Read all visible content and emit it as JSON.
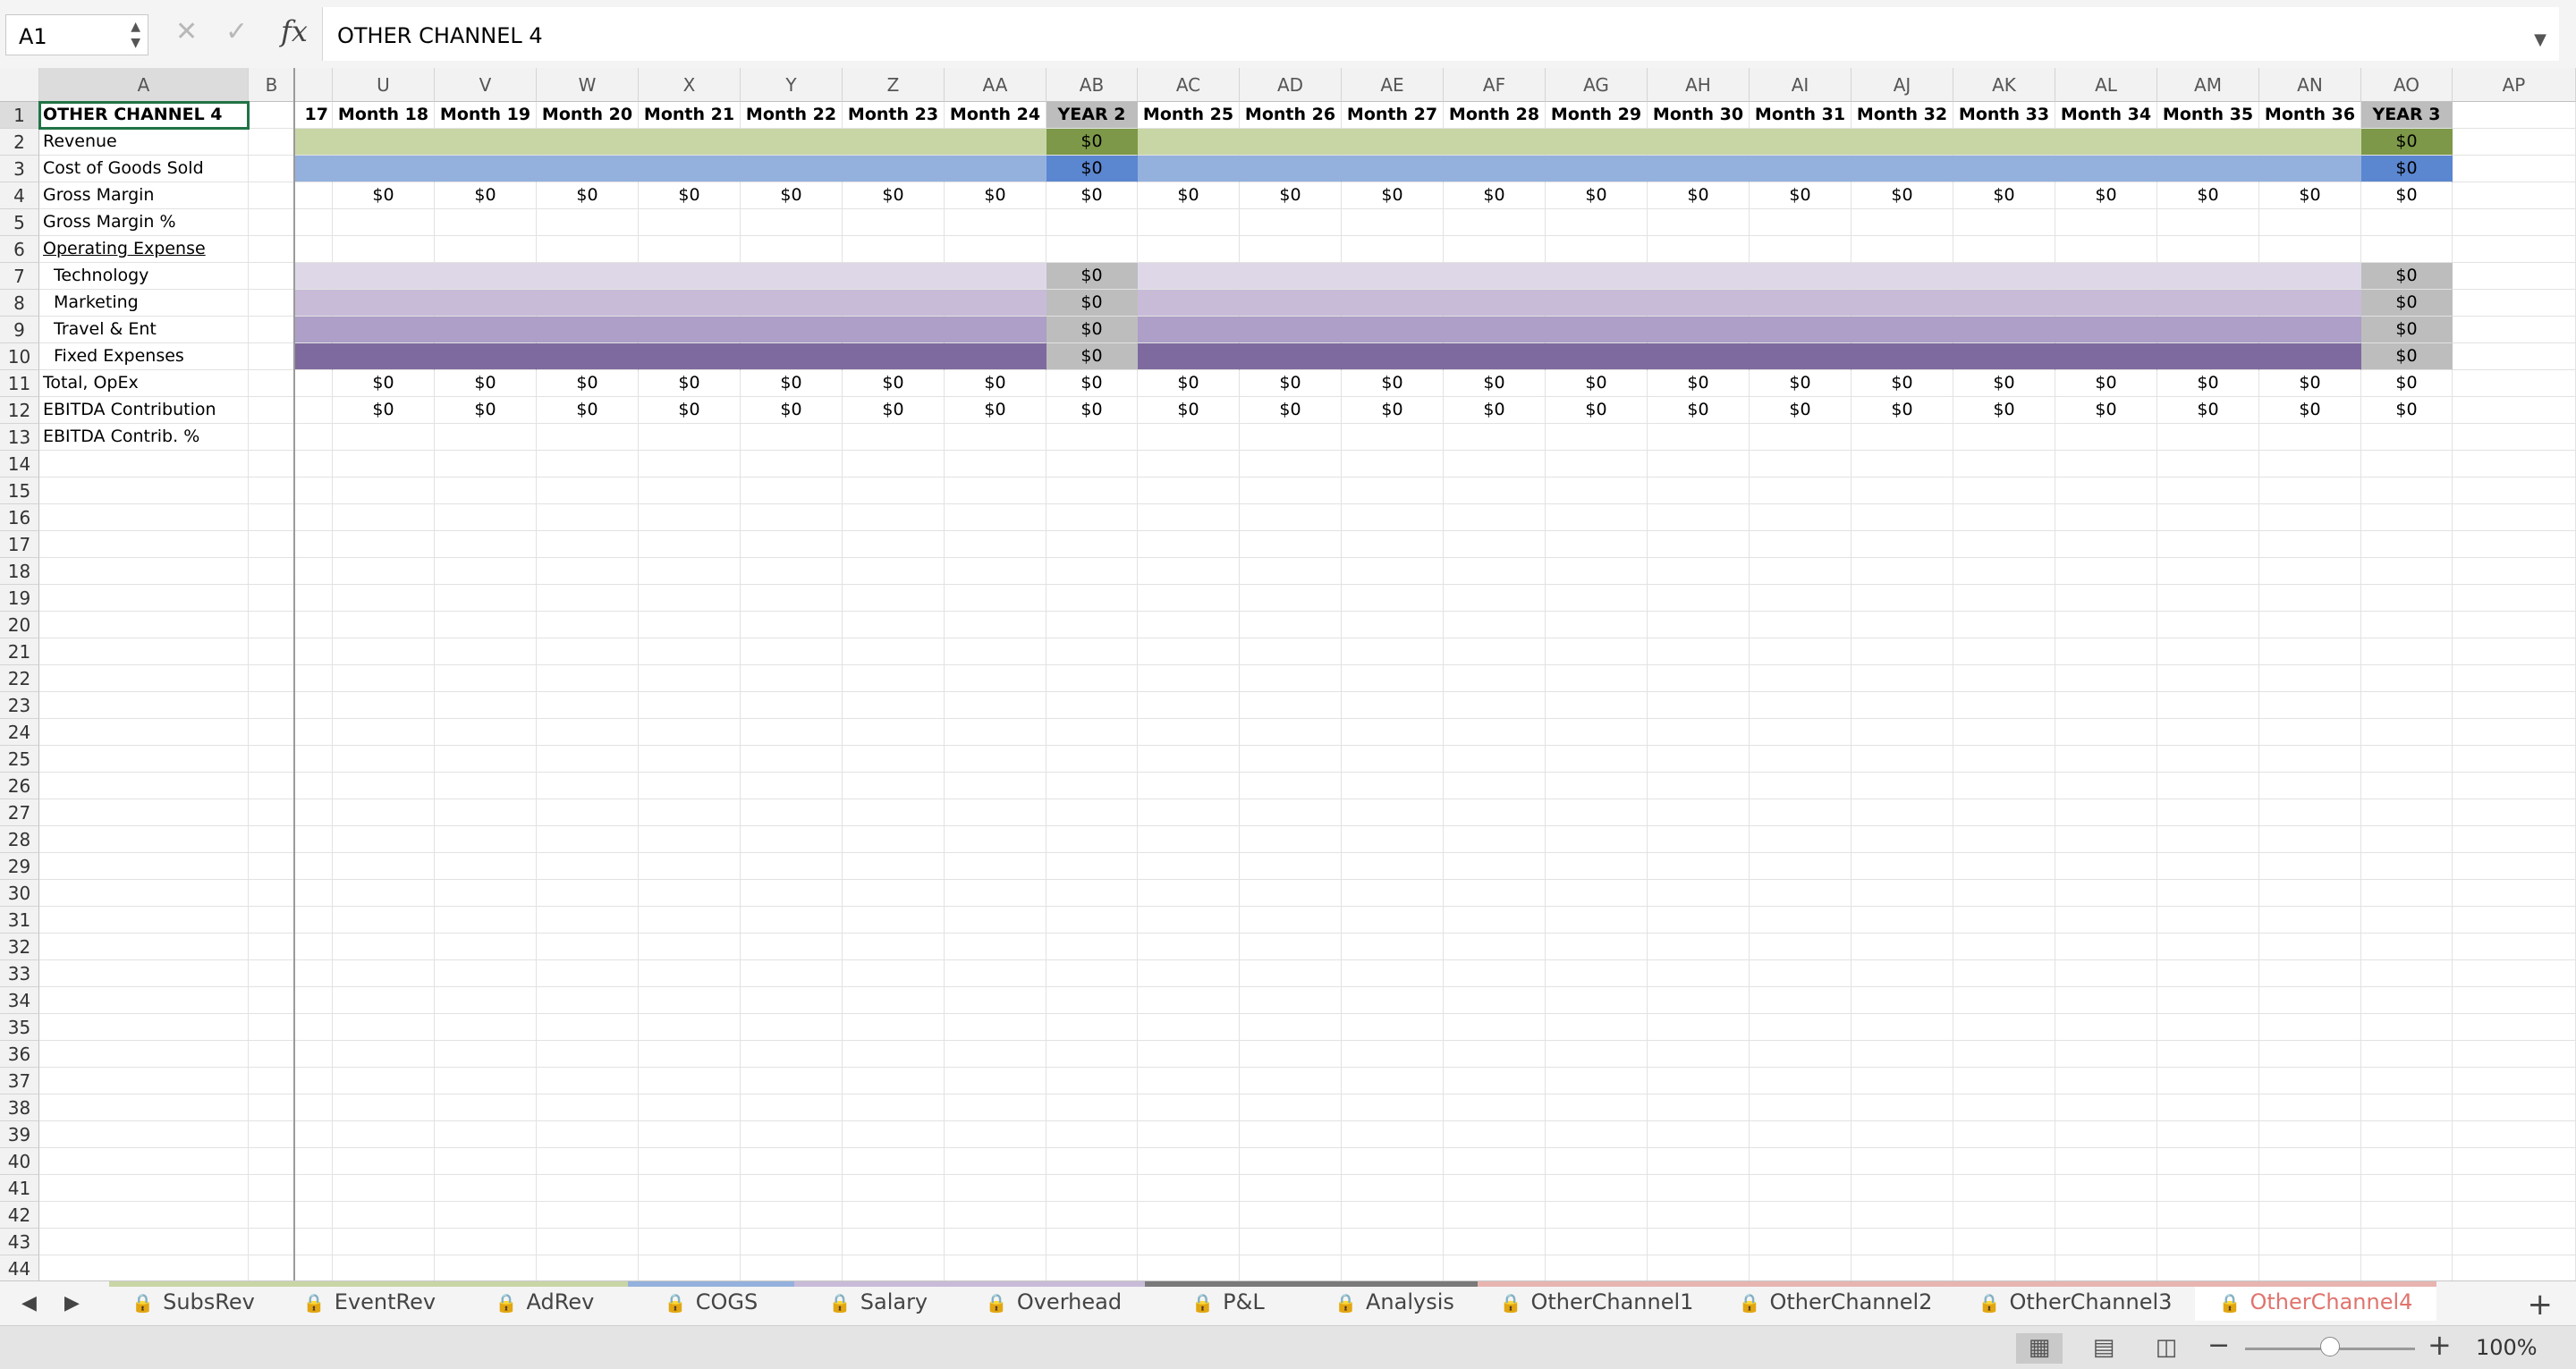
{
  "formula_bar": {
    "name_box": "A1",
    "cancel_icon": "close-icon",
    "enter_icon": "checkmark-icon",
    "fx_label": "fx",
    "formula": "OTHER CHANNEL 4"
  },
  "columns": [
    "A",
    "B",
    "U",
    "V",
    "W",
    "X",
    "Y",
    "Z",
    "AA",
    "AB",
    "AC",
    "AD",
    "AE",
    "AF",
    "AG",
    "AH",
    "AI",
    "AJ",
    "AK",
    "AL",
    "AM",
    "AN",
    "AO",
    "AP"
  ],
  "frozen_col_partial_label": "17",
  "row_labels": [
    "OTHER CHANNEL 4",
    "Revenue",
    "Cost of Goods Sold",
    "Gross Margin",
    "Gross Margin %",
    "Operating Expense",
    "Technology",
    "Marketing",
    "Travel & Ent",
    "Fixed Expenses",
    "Total, OpEx",
    "EBITDA Contribution",
    "EBITDA Contrib. %"
  ],
  "period_headers": [
    "Month 18",
    "Month 19",
    "Month 20",
    "Month 21",
    "Month 22",
    "Month 23",
    "Month 24",
    "YEAR 2",
    "Month 25",
    "Month 26",
    "Month 27",
    "Month 28",
    "Month 29",
    "Month 30",
    "Month 31",
    "Month 32",
    "Month 33",
    "Month 34",
    "Month 35",
    "Month 36",
    "YEAR 3"
  ],
  "value": "$0",
  "row_count": 44,
  "colors": {
    "revenue": "#c8d6a6",
    "revenue_total": "#7d9848",
    "cogs": "#94b1dd",
    "cogs_total": "#5b86d0",
    "technology": "#ddd7e8",
    "marketing": "#c8bbd8",
    "travel": "#ad9fc7",
    "fixed": "#7e6a9e",
    "year_header": "#bdbdbd",
    "active_tab": "#e0736d"
  },
  "sheet_tabs": [
    {
      "label": "SubsRev",
      "color": "#c8d6a6",
      "locked": true
    },
    {
      "label": "EventRev",
      "color": "#c8d6a6",
      "locked": true
    },
    {
      "label": "AdRev",
      "color": "#c8d6a6",
      "locked": true
    },
    {
      "label": "COGS",
      "color": "#94b1dd",
      "locked": true
    },
    {
      "label": "Salary",
      "color": "#c8bbd8",
      "locked": true
    },
    {
      "label": "Overhead",
      "color": "#c8bbd8",
      "locked": true
    },
    {
      "label": "P&L",
      "color": "#7a7a7a",
      "locked": true
    },
    {
      "label": "Analysis",
      "color": "#7a7a7a",
      "locked": true
    },
    {
      "label": "OtherChannel1",
      "color": "#e8b4b0",
      "locked": true
    },
    {
      "label": "OtherChannel2",
      "color": "#e8b4b0",
      "locked": true
    },
    {
      "label": "OtherChannel3",
      "color": "#e8b4b0",
      "locked": true
    },
    {
      "label": "OtherChannel4",
      "color": "#e8b4b0",
      "locked": true,
      "active": true
    }
  ],
  "status": {
    "view_normal_icon": "grid-view-icon",
    "view_page_layout_icon": "page-layout-icon",
    "view_page_break_icon": "page-break-icon",
    "zoom": "100%"
  }
}
